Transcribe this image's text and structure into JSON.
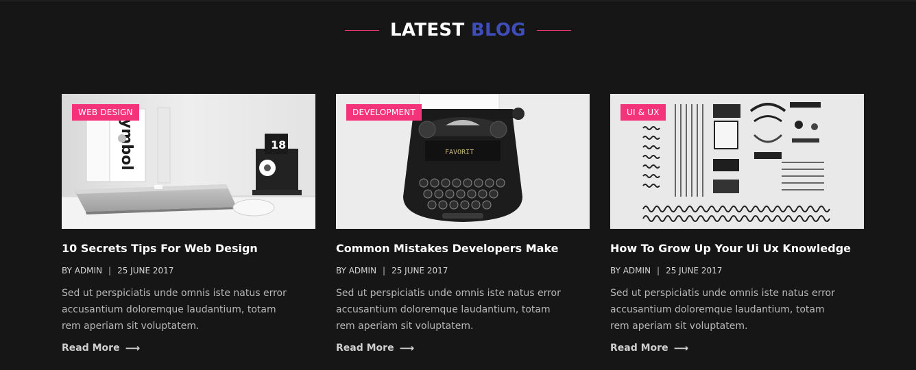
{
  "section": {
    "title_word1": "LATEST",
    "title_word2": "BLOG",
    "accent_color": "#3f4db8",
    "line_color": "#e2366e"
  },
  "posts": [
    {
      "category": "WEB DESIGN",
      "title": "10 Secrets Tips For Web Design",
      "author": "BY ADMIN",
      "separator": "|",
      "date": "25 JUNE 2017",
      "excerpt": "Sed ut perspiciatis unde omnis iste natus error accusantium doloremque laudantium, totam rem aperiam sit voluptatem.",
      "read_more": "Read More",
      "arrow": "⟶",
      "badge_text": "18",
      "book_text": "ymbol"
    },
    {
      "category": "DEVELOPMENT",
      "title": "Common Mistakes Developers Make",
      "author": "BY ADMIN",
      "separator": "|",
      "date": "25 JUNE 2017",
      "excerpt": "Sed ut perspiciatis unde omnis iste natus error accusantium doloremque laudantium, totam rem aperiam sit voluptatem.",
      "read_more": "Read More",
      "arrow": "⟶",
      "brand_text": "FAVORIT"
    },
    {
      "category": "UI & UX",
      "title": "How To Grow Up Your Ui Ux Knowledge",
      "author": "BY ADMIN",
      "separator": "|",
      "date": "25 JUNE 2017",
      "excerpt": "Sed ut perspiciatis unde omnis iste natus error accusantium doloremque laudantium, totam rem aperiam sit voluptatem.",
      "read_more": "Read More",
      "arrow": "⟶"
    }
  ],
  "colors": {
    "background": "#161617",
    "badge": "#f3347a"
  }
}
